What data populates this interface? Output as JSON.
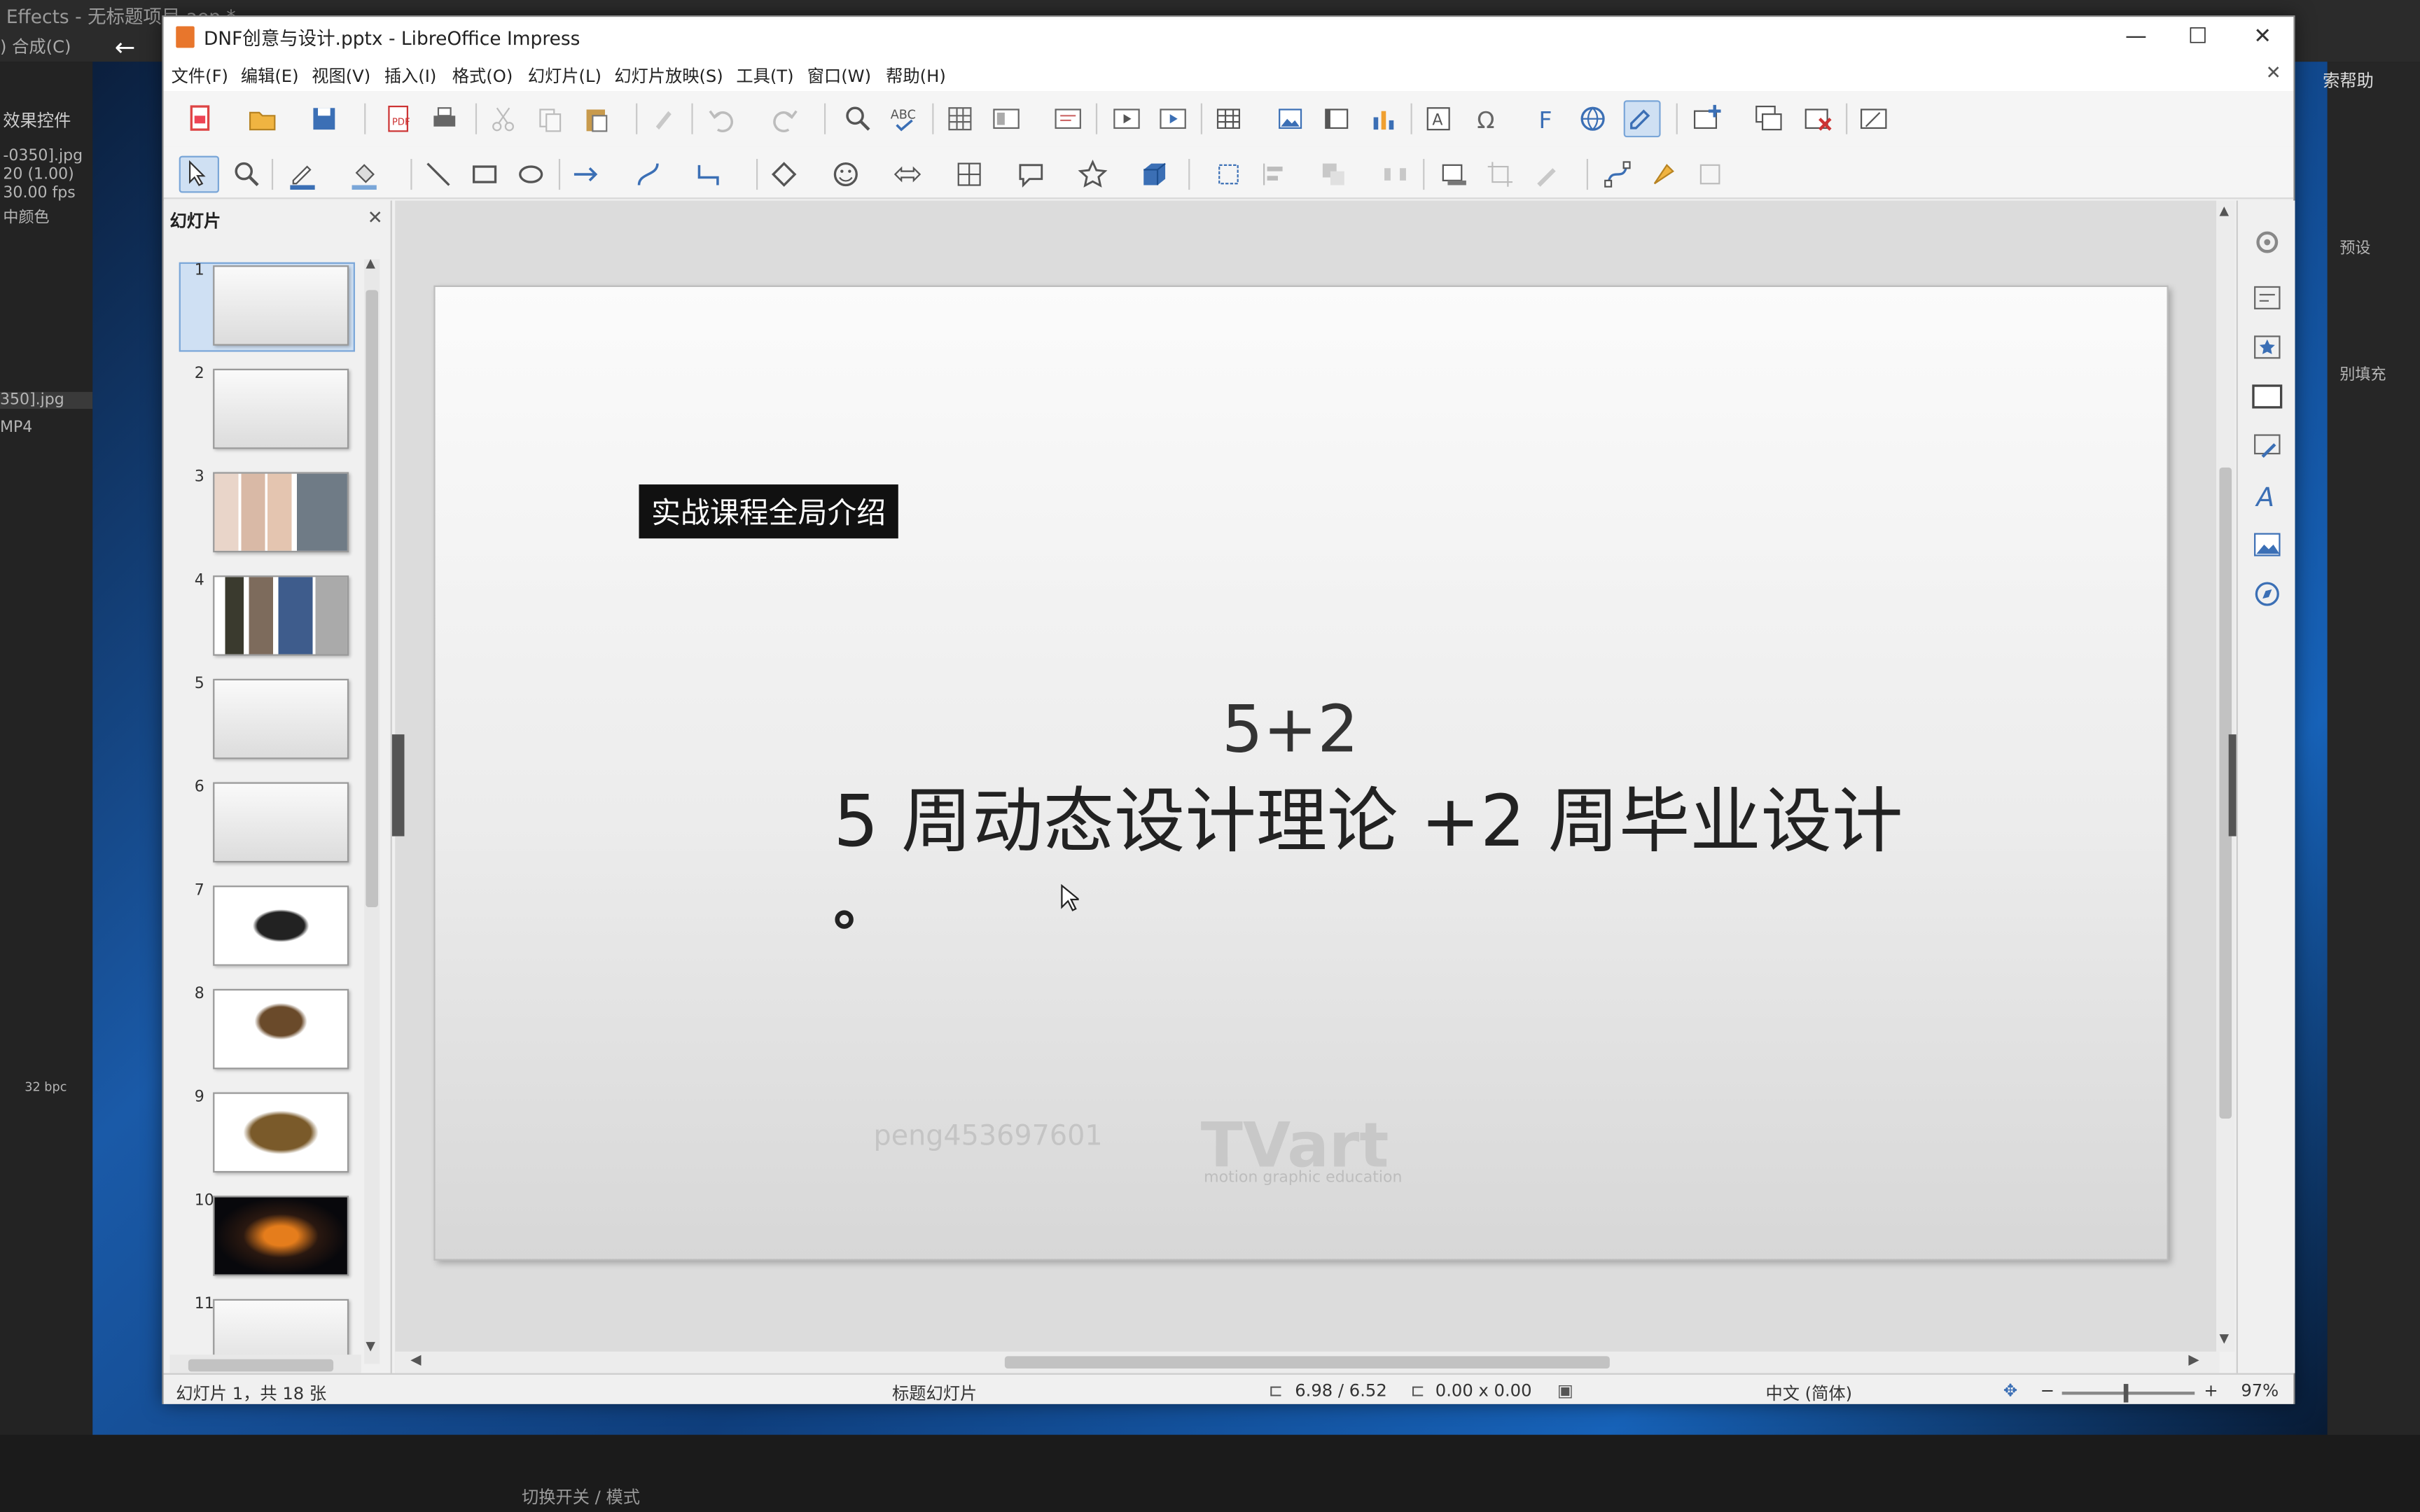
{
  "background_app": {
    "title": "Effects - 无标题项目.aep *",
    "menu": ") 合成(C)",
    "panel_label": "效果控件",
    "file_1": "-0350].jpg",
    "file_1_meta_1": "20 (1.00)",
    "file_1_meta_2": "30.00 fps",
    "file_1_meta_3": "中颜色",
    "file_2": "350].jpg",
    "file_2_meta": "MP4",
    "bpc": "32 bpc",
    "bottom_toggle": "切换开关 / 模式",
    "help": "索帮助",
    "right_labels": [
      "预设",
      "别填充"
    ]
  },
  "window": {
    "title": "DNF创意与设计.pptx - LibreOffice Impress",
    "minimize": "—",
    "maximize": "☐",
    "close": "✕",
    "doc_close": "✕"
  },
  "menu": [
    "文件(F)",
    "编辑(E)",
    "视图(V)",
    "插入(I)",
    "格式(O)",
    "幻灯片(L)",
    "幻灯片放映(S)",
    "工具(T)",
    "窗口(W)",
    "帮助(H)"
  ],
  "slide_pane": {
    "title": "幻灯片",
    "close": "✕",
    "thumbnails": [
      "1",
      "2",
      "3",
      "4",
      "5",
      "6",
      "7",
      "8",
      "9",
      "10",
      "11"
    ],
    "selected": 1
  },
  "slide": {
    "label": "实战课程全局介绍",
    "title": "5+2",
    "subtitle": "5 周动态设计理论 +2 周毕业设计",
    "watermark": "peng453697601",
    "logo": "TVart",
    "logo_sub": "motion graphic education"
  },
  "status": {
    "slide_info": "幻灯片 1，共 18 张",
    "layout": "标题幻灯片",
    "position": "6.98 / 6.52",
    "size": "0.00 x 0.00",
    "language": "中文 (简体)",
    "zoom_minus": "−",
    "zoom_plus": "+",
    "zoom": "97%"
  },
  "colors": {
    "accent": "#4a90d9",
    "selection": "#cfe0f3",
    "label_bg": "#111111"
  }
}
